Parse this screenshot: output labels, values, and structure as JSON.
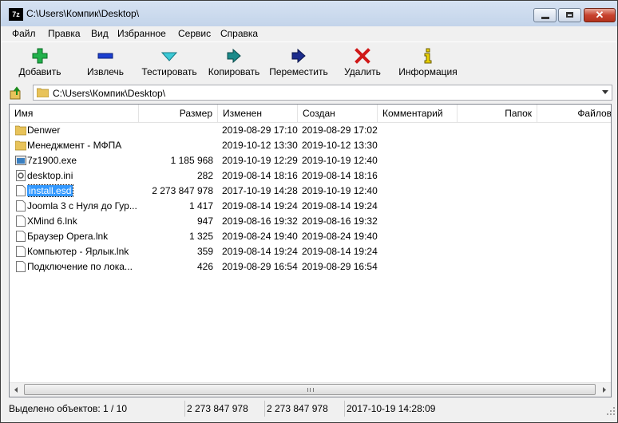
{
  "window": {
    "title": "C:\\Users\\Компик\\Desktop\\",
    "app_icon_text": "7z"
  },
  "menu": [
    "Файл",
    "Правка",
    "Вид",
    "Избранное",
    "Сервис",
    "Справка"
  ],
  "toolbar": [
    {
      "label": "Добавить",
      "icon": "plus-icon",
      "color": "#22b14c"
    },
    {
      "label": "Извлечь",
      "icon": "minus-icon",
      "color": "#1c3fd0"
    },
    {
      "label": "Тестировать",
      "icon": "check-icon",
      "color": "#3dc9d6"
    },
    {
      "label": "Копировать",
      "icon": "copy-arrow-icon",
      "color": "#1b8a8a"
    },
    {
      "label": "Переместить",
      "icon": "move-arrow-icon",
      "color": "#1c2c8c"
    },
    {
      "label": "Удалить",
      "icon": "delete-x-icon",
      "color": "#d01818"
    },
    {
      "label": "Информация",
      "icon": "info-icon",
      "color": "#e8d000"
    }
  ],
  "address": {
    "path": "C:\\Users\\Компик\\Desktop\\"
  },
  "columns": [
    "Имя",
    "Размер",
    "Изменен",
    "Создан",
    "Комментарий",
    "Папок",
    "Файлов"
  ],
  "files": [
    {
      "name": "Denwer",
      "size": "",
      "modified": "2019-08-29 17:10",
      "created": "2019-08-29 17:02",
      "type": "folder"
    },
    {
      "name": "Менеджмент - МФПА",
      "size": "",
      "modified": "2019-10-12 13:30",
      "created": "2019-10-12 13:30",
      "type": "folder"
    },
    {
      "name": "7z1900.exe",
      "size": "1 185 968",
      "modified": "2019-10-19 12:29",
      "created": "2019-10-19 12:40",
      "type": "exe"
    },
    {
      "name": "desktop.ini",
      "size": "282",
      "modified": "2019-08-14 18:16",
      "created": "2019-08-14 18:16",
      "type": "ini"
    },
    {
      "name": "install.esd",
      "size": "2 273 847 978",
      "modified": "2017-10-19 14:28",
      "created": "2019-10-19 12:40",
      "type": "file",
      "selected": true
    },
    {
      "name": "Joomla 3 с Нуля до Гур...",
      "size": "1 417",
      "modified": "2019-08-14 19:24",
      "created": "2019-08-14 19:24",
      "type": "file"
    },
    {
      "name": "XMind 6.lnk",
      "size": "947",
      "modified": "2019-08-16 19:32",
      "created": "2019-08-16 19:32",
      "type": "file"
    },
    {
      "name": "Браузер Opera.lnk",
      "size": "1 325",
      "modified": "2019-08-24 19:40",
      "created": "2019-08-24 19:40",
      "type": "file"
    },
    {
      "name": "Компьютер - Ярлык.lnk",
      "size": "359",
      "modified": "2019-08-14 19:24",
      "created": "2019-08-14 19:24",
      "type": "file"
    },
    {
      "name": "Подключение по лока...",
      "size": "426",
      "modified": "2019-08-29 16:54",
      "created": "2019-08-29 16:54",
      "type": "file"
    }
  ],
  "status": {
    "selected": "Выделено объектов: 1 / 10",
    "size": "2 273 847 978",
    "packed": "2 273 847 978",
    "date": "2017-10-19 14:28:09"
  }
}
